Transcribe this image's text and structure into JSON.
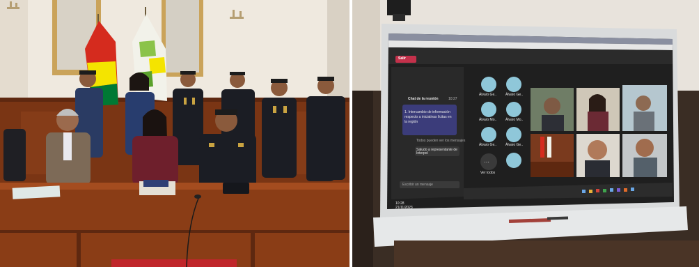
{
  "left_photo": {
    "colors": {
      "wall": "#efe9df",
      "wood": "#8a3d16",
      "flag_red": "#d52b1e",
      "flag_yellow": "#f4e400",
      "flag_green": "#007934",
      "uniform": "#1b1d24"
    }
  },
  "right_photo": {
    "meeting_ui": {
      "leave_button": "Salir",
      "chat_title": "Chat de la reunión",
      "chat_time": "10:27",
      "chat_message": "1. Intercambio de información respecto a iniciativas lícitas en la región",
      "chat_system_note": "Todos pueden ver los mensajes",
      "chat_reply": "Saludo a representante de Interpol",
      "chat_input_placeholder": "Escribir un mensaje",
      "clock_time": "10:28",
      "clock_date": "21/11/2023",
      "participants": [
        "Álvaro Ge..",
        "Álvaro Ge..",
        "Álvaro Mo..",
        "Álvaro Mo..",
        "Álvaro Ge..",
        "Álvaro Ge.."
      ],
      "more_label": "Ver todos",
      "colors": {
        "bg": "#1f1f1f",
        "leave": "#c4314b",
        "accent": "#6264a7",
        "avatar": "#8fc7d9"
      }
    }
  }
}
